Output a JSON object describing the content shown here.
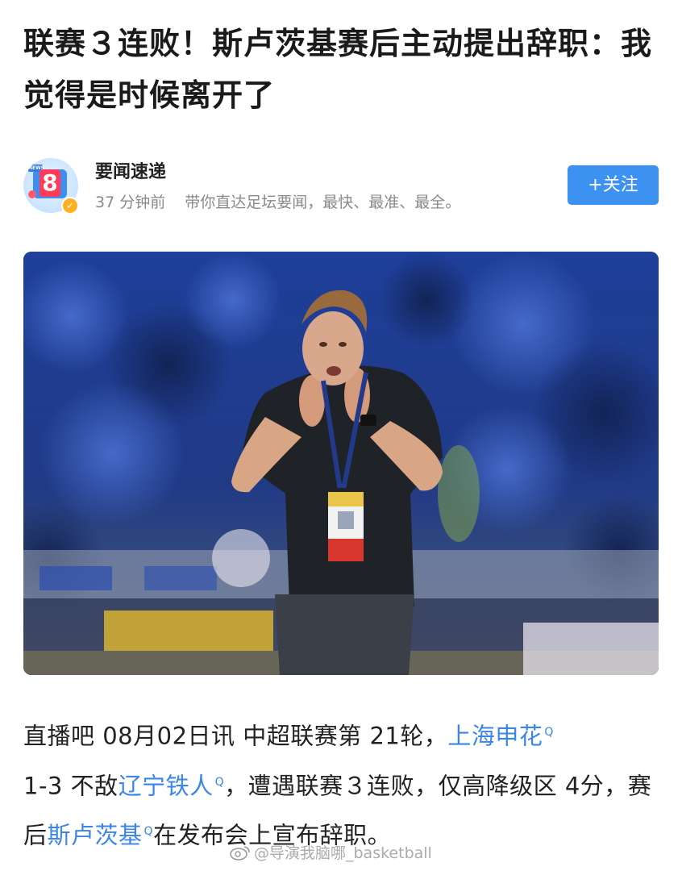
{
  "article": {
    "title": "联赛３连败！斯卢茨基赛后主动提出辞职：我觉得是时候离开了"
  },
  "author": {
    "name": "要闻速递",
    "time": "37 分钟前",
    "bio": "带你直达足坛要闻，最快、最准、最全。",
    "avatar_number": "8",
    "avatar_badge": "NEWS",
    "follow_label": "+关注",
    "verified_icon": "verified-badge-icon"
  },
  "photo": {
    "subject_icon": "coach-photo"
  },
  "body": {
    "p1": "直播吧 08月02日讯   中超联赛第 21轮，",
    "link1": "上海申花",
    "p2": "1-3 不敌",
    "link2": "辽宁铁人",
    "p3": "，遭遇联赛３连败，仅高降级区 4分，赛后",
    "link3": "斯卢茨基",
    "p4": "在发布会上宣布辞职。",
    "link_marker": "Q"
  },
  "watermark": {
    "text": "@导演我脑哪_basketball"
  },
  "colors": {
    "accent": "#3d91f0",
    "link": "#3a86e8",
    "meta": "#8a8a8a"
  }
}
